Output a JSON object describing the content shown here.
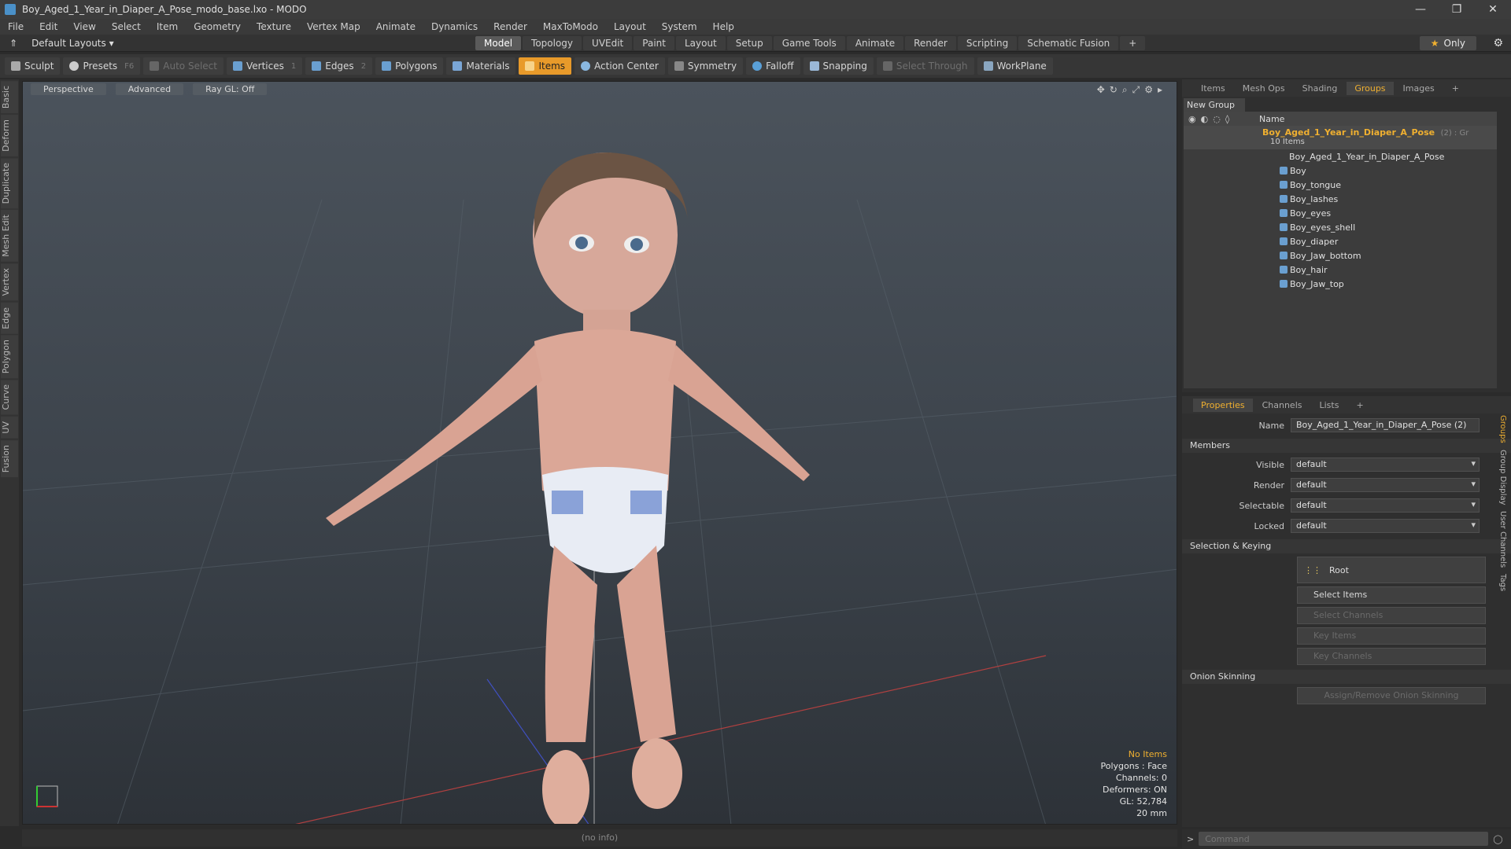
{
  "window": {
    "title": "Boy_Aged_1_Year_in_Diaper_A_Pose_modo_base.lxo - MODO"
  },
  "menu": [
    "File",
    "Edit",
    "View",
    "Select",
    "Item",
    "Geometry",
    "Texture",
    "Vertex Map",
    "Animate",
    "Dynamics",
    "Render",
    "MaxToModo",
    "Layout",
    "System",
    "Help"
  ],
  "layout": {
    "current": "Default Layouts ▾",
    "tabs": [
      "Model",
      "Topology",
      "UVEdit",
      "Paint",
      "Layout",
      "Setup",
      "Game Tools",
      "Animate",
      "Render",
      "Scripting",
      "Schematic Fusion"
    ],
    "active_tab": "Model",
    "add": "+",
    "only": "Only"
  },
  "toolbar": {
    "sculpt": "Sculpt",
    "presets": "Presets",
    "presets_key": "F6",
    "auto_select": "Auto Select",
    "vertices": "Vertices",
    "vertices_key": "1",
    "edges": "Edges",
    "edges_key": "2",
    "polygons": "Polygons",
    "materials": "Materials",
    "items": "Items",
    "action_center": "Action Center",
    "symmetry": "Symmetry",
    "falloff": "Falloff",
    "snapping": "Snapping",
    "select_through": "Select Through",
    "workplane": "WorkPlane"
  },
  "left_tabs": [
    "Basic",
    "Deform",
    "Duplicate",
    "Mesh Edit",
    "Vertex",
    "Edge",
    "Polygon",
    "Curve",
    "UV",
    "Fusion"
  ],
  "viewport": {
    "header": [
      "Perspective",
      "Advanced",
      "Ray GL: Off"
    ],
    "info": {
      "selection": "No Items",
      "polygons": "Polygons : Face",
      "channels": "Channels: 0",
      "deformers": "Deformers: ON",
      "gl": "GL: 52,784",
      "scale": "20 mm"
    },
    "status": "(no info)"
  },
  "groups_panel": {
    "tabs": [
      "Items",
      "Mesh Ops",
      "Shading",
      "Groups",
      "Images",
      "+"
    ],
    "active_tab": "Groups",
    "new_group": "New Group",
    "col_name": "Name",
    "group": {
      "name": "Boy_Aged_1_Year_in_Diaper_A_Pose",
      "suffix": "(2) : Gr",
      "count": "10 Items"
    },
    "items": [
      "Boy_Aged_1_Year_in_Diaper_A_Pose",
      "Boy",
      "Boy_tongue",
      "Boy_lashes",
      "Boy_eyes",
      "Boy_eyes_shell",
      "Boy_diaper",
      "Boy_Jaw_bottom",
      "Boy_hair",
      "Boy_Jaw_top"
    ]
  },
  "properties_panel": {
    "tabs": [
      "Properties",
      "Channels",
      "Lists",
      "+"
    ],
    "active_tab": "Properties",
    "name_label": "Name",
    "name_value": "Boy_Aged_1_Year_in_Diaper_A_Pose (2)",
    "members": "Members",
    "visible_label": "Visible",
    "visible": "default",
    "render_label": "Render",
    "render": "default",
    "selectable_label": "Selectable",
    "selectable": "default",
    "locked_label": "Locked",
    "locked": "default",
    "selection_keying": "Selection & Keying",
    "root": "Root",
    "select_items": "Select Items",
    "select_channels": "Select Channels",
    "key_items": "Key Items",
    "key_channels": "Key Channels",
    "onion": "Onion Skinning",
    "assign_onion": "Assign/Remove Onion Skinning",
    "side_tabs": [
      "Groups",
      "Group Display",
      "User Channels",
      "Tags"
    ]
  },
  "command": {
    "placeholder": "Command"
  },
  "colors": {
    "accent": "#f0b030",
    "items_active": "#e89a2a"
  }
}
